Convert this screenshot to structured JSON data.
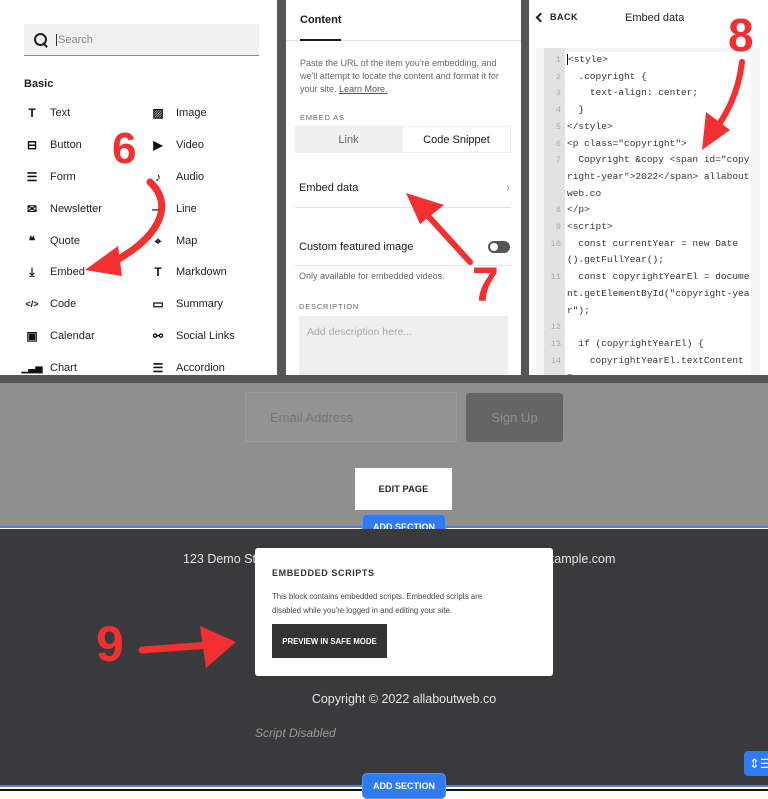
{
  "blocks_panel": {
    "search_placeholder": "Search",
    "section_title": "Basic",
    "items": [
      {
        "label": "Text",
        "icon": "T"
      },
      {
        "label": "Image",
        "icon": "▨"
      },
      {
        "label": "Button",
        "icon": "⊟"
      },
      {
        "label": "Video",
        "icon": "▶"
      },
      {
        "label": "Form",
        "icon": "☰"
      },
      {
        "label": "Audio",
        "icon": "♪"
      },
      {
        "label": "Newsletter",
        "icon": "✉"
      },
      {
        "label": "Line",
        "icon": "—"
      },
      {
        "label": "Quote",
        "icon": "❝"
      },
      {
        "label": "Map",
        "icon": "⌖"
      },
      {
        "label": "Embed",
        "icon": "⤓"
      },
      {
        "label": "Markdown",
        "icon": "T"
      },
      {
        "label": "Code",
        "icon": "</>"
      },
      {
        "label": "Summary",
        "icon": "▭"
      },
      {
        "label": "Calendar",
        "icon": "▣"
      },
      {
        "label": "Social Links",
        "icon": "⚯"
      },
      {
        "label": "Chart",
        "icon": "▁▃▅"
      },
      {
        "label": "Accordion",
        "icon": "☰"
      }
    ]
  },
  "embed_panel": {
    "tab": "Content",
    "description": "Paste the URL of the item you're embedding, and we'll attempt to locate the content and format it for your site.",
    "learn_more": "Learn More.",
    "embed_as_label": "EMBED AS",
    "embed_as_options": [
      "Link",
      "Code Snippet"
    ],
    "embed_as_selected": "Code Snippet",
    "embed_data_label": "Embed data",
    "custom_image_label": "Custom featured image",
    "custom_image_enabled": false,
    "custom_image_note": "Only available for embedded videos.",
    "description_label": "DESCRIPTION",
    "description_placeholder": "Add description here..."
  },
  "embed_data_panel": {
    "back_label": "BACK",
    "title": "Embed data",
    "code_lines": [
      {
        "n": "1",
        "text": "<style>"
      },
      {
        "n": "2",
        "text": "  .copyright {"
      },
      {
        "n": "3",
        "text": "    text-align: center;"
      },
      {
        "n": "4",
        "text": "  }"
      },
      {
        "n": "5",
        "text": "</style>"
      },
      {
        "n": "6",
        "text": "<p class=\"copyright\">"
      },
      {
        "n": "7",
        "text": "  Copyright &copy <span id=\"copyright-year\">2022</span> allaboutweb.co"
      },
      {
        "n": "8",
        "text": "</p>"
      },
      {
        "n": "9",
        "text": "<script>"
      },
      {
        "n": "10",
        "text": "  const currentYear = new Date().getFullYear();"
      },
      {
        "n": "11",
        "text": "  const copyrightYearEl = document.getElementById(\"copyright-year\");"
      },
      {
        "n": "12",
        "text": ""
      },
      {
        "n": "13",
        "text": "  if (copyrightYearEl) {"
      },
      {
        "n": "14",
        "text": "    copyrightYearEl.textContent ="
      },
      {
        "n": "",
        "text": "      \"\""
      }
    ]
  },
  "page_section": {
    "email_placeholder": "Email Address",
    "signup_label": "Sign Up",
    "edit_page_label": "EDIT PAGE",
    "add_section_label": "ADD SECTION"
  },
  "footer": {
    "address_left": "123 Demo St",
    "address_right": "xample.com",
    "modal_title": "EMBEDDED SCRIPTS",
    "modal_body": "This block contains embedded scripts. Embedded scripts are disabled while you're logged in and editing your site.",
    "modal_button": "PREVIEW IN SAFE MODE",
    "copyright": "Copyright © 2022 allaboutweb.co",
    "script_disabled": "Script Disabled",
    "add_section_label": "ADD SECTION",
    "side_button_icon": "⇕☰"
  },
  "annotations": [
    "6",
    "7",
    "8",
    "9"
  ],
  "colors": {
    "accent_blue": "#2f7bf0",
    "annotation_red": "#f23030",
    "footer_bg": "#3a3a3c"
  }
}
